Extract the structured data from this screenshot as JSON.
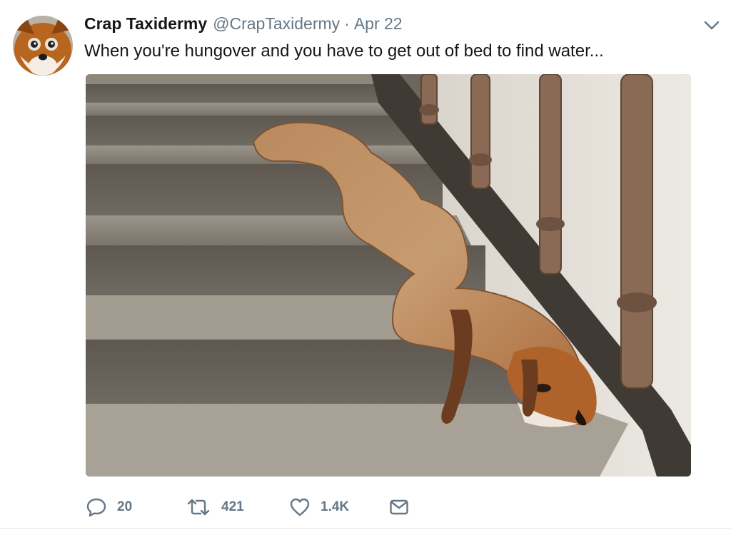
{
  "tweet": {
    "author": {
      "display_name": "Crap Taxidermy",
      "handle": "@CrapTaxidermy",
      "avatar_icon": "fox-avatar"
    },
    "separator": "·",
    "date": "Apr 22",
    "text": "When you're hungover and you have to get out of bed to find water...",
    "menu_icon": "chevron-down-icon",
    "media": {
      "type": "photo",
      "icon": "taxidermy-fox-on-stairs-photo"
    },
    "actions": {
      "reply": {
        "icon": "reply-icon",
        "count": "20"
      },
      "retweet": {
        "icon": "retweet-icon",
        "count": "421"
      },
      "like": {
        "icon": "heart-icon",
        "count": "1.4K"
      },
      "dm": {
        "icon": "envelope-icon"
      }
    }
  },
  "colors": {
    "text_primary": "#14171a",
    "text_secondary": "#657786",
    "divider": "#e1e8ed"
  }
}
